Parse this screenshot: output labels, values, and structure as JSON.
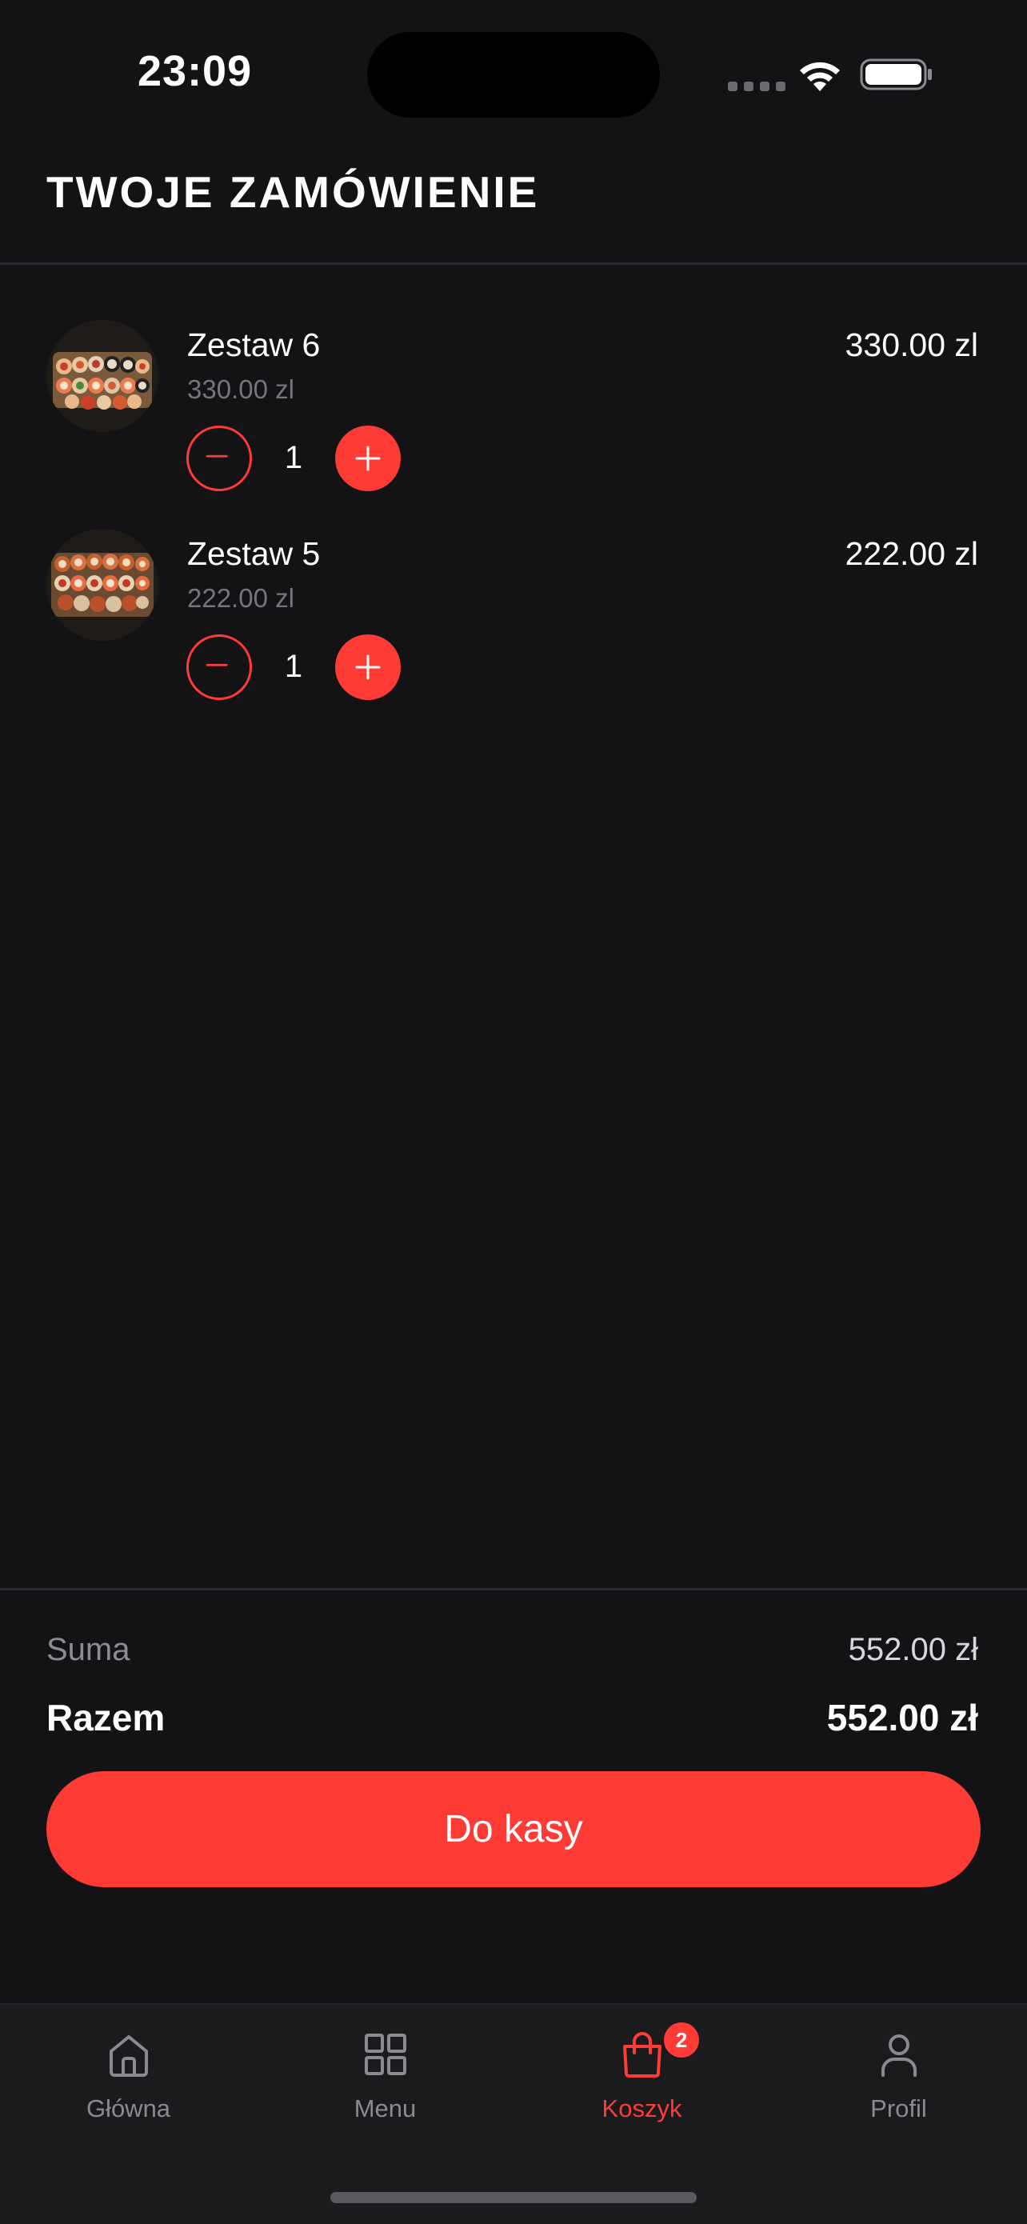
{
  "status_bar": {
    "time": "23:09"
  },
  "header": {
    "title": "TWOJE ZAMÓWIENIE"
  },
  "cart": {
    "items": [
      {
        "name": "Zestaw 6",
        "unit_price": "330.00 zl",
        "total_price": "330.00 zl",
        "quantity": "1",
        "image_icon": "sushi-set-image"
      },
      {
        "name": "Zestaw 5",
        "unit_price": "222.00 zl",
        "total_price": "222.00 zl",
        "quantity": "1",
        "image_icon": "sushi-set-image"
      }
    ]
  },
  "summary": {
    "subtotal_label": "Suma",
    "subtotal_value": "552.00 zł",
    "total_label": "Razem",
    "total_value": "552.00 zł",
    "checkout_label": "Do kasy"
  },
  "tab_bar": {
    "tabs": [
      {
        "label": "Główna",
        "icon": "home-icon",
        "active": false
      },
      {
        "label": "Menu",
        "icon": "grid-icon",
        "active": false
      },
      {
        "label": "Koszyk",
        "icon": "bag-icon",
        "active": true,
        "badge": "2"
      },
      {
        "label": "Profil",
        "icon": "person-icon",
        "active": false
      }
    ]
  },
  "colors": {
    "background": "#131315",
    "accent": "#ff3b36",
    "muted_text": "#75757a",
    "tab_bar_background": "#1b1b1e"
  }
}
